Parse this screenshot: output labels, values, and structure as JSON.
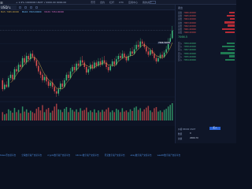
{
  "topbar": {
    "logo": "☰",
    "ticker": "+ 1.9% 1900000 USDT   √ 0000.00   0000.00",
    "tabs": [
      "币币",
      "合约",
      "杠杆",
      "OTC",
      "应用中心",
      "我的资产"
    ]
  },
  "toolbar": {
    "pair": "USD/↓"
  },
  "chart": {
    "ma_legend": [
      "MA5: 7065.00000",
      "MA10: 7063.00000",
      "MA30: 7054.00000"
    ],
    "last_price": "7066.50000",
    "candles": [
      [
        50,
        42,
        52,
        40
      ],
      [
        42,
        46,
        48,
        41
      ],
      [
        46,
        44,
        49,
        43
      ],
      [
        44,
        52,
        54,
        43
      ],
      [
        52,
        55,
        58,
        50
      ],
      [
        55,
        51,
        57,
        49
      ],
      [
        51,
        60,
        62,
        50
      ],
      [
        60,
        58,
        63,
        56
      ],
      [
        58,
        64,
        66,
        57
      ],
      [
        64,
        62,
        67,
        60
      ],
      [
        62,
        70,
        72,
        61
      ],
      [
        70,
        66,
        73,
        64
      ],
      [
        66,
        72,
        75,
        64
      ],
      [
        72,
        69,
        74,
        66
      ],
      [
        69,
        74,
        76,
        67
      ],
      [
        74,
        71,
        77,
        70
      ],
      [
        71,
        68,
        73,
        66
      ],
      [
        68,
        63,
        70,
        61
      ],
      [
        63,
        58,
        66,
        56
      ],
      [
        58,
        55,
        60,
        52
      ],
      [
        55,
        50,
        57,
        48
      ],
      [
        50,
        53,
        56,
        48
      ],
      [
        53,
        49,
        55,
        46
      ],
      [
        49,
        45,
        51,
        43
      ],
      [
        45,
        48,
        50,
        43
      ],
      [
        48,
        44,
        51,
        42
      ],
      [
        44,
        40,
        46,
        38
      ],
      [
        40,
        38,
        43,
        35
      ],
      [
        38,
        42,
        44,
        36
      ],
      [
        42,
        47,
        49,
        40
      ],
      [
        47,
        44,
        50,
        42
      ],
      [
        44,
        50,
        52,
        43
      ],
      [
        50,
        55,
        57,
        49
      ],
      [
        55,
        52,
        58,
        50
      ],
      [
        52,
        58,
        61,
        51
      ],
      [
        58,
        62,
        64,
        56
      ],
      [
        62,
        59,
        65,
        57
      ],
      [
        59,
        65,
        67,
        58
      ],
      [
        65,
        63,
        68,
        60
      ],
      [
        63,
        68,
        71,
        62
      ],
      [
        68,
        66,
        72,
        64
      ],
      [
        66,
        62,
        68,
        60
      ],
      [
        62,
        57,
        64,
        55
      ],
      [
        57,
        60,
        62,
        55
      ],
      [
        60,
        64,
        66,
        58
      ],
      [
        64,
        61,
        67,
        59
      ],
      [
        61,
        66,
        68,
        60
      ],
      [
        66,
        63,
        68,
        61
      ],
      [
        63,
        67,
        70,
        62
      ],
      [
        67,
        64,
        70,
        62
      ],
      [
        64,
        68,
        71,
        63
      ],
      [
        68,
        66,
        72,
        64
      ],
      [
        66,
        62,
        68,
        60
      ],
      [
        62,
        59,
        64,
        57
      ],
      [
        59,
        63,
        65,
        58
      ],
      [
        63,
        67,
        69,
        62
      ],
      [
        67,
        64,
        70,
        62
      ],
      [
        64,
        69,
        72,
        63
      ],
      [
        69,
        72,
        74,
        67
      ],
      [
        72,
        70,
        75,
        68
      ],
      [
        70,
        74,
        77,
        69
      ],
      [
        74,
        71,
        76,
        69
      ],
      [
        71,
        68,
        73,
        66
      ],
      [
        68,
        72,
        74,
        67
      ],
      [
        72,
        76,
        79,
        71
      ],
      [
        76,
        74,
        80,
        72
      ],
      [
        74,
        78,
        82,
        73
      ],
      [
        78,
        82,
        85,
        77
      ],
      [
        82,
        80,
        86,
        78
      ],
      [
        80,
        85,
        88,
        79
      ],
      [
        85,
        83,
        87,
        81
      ],
      [
        83,
        80,
        85,
        78
      ],
      [
        80,
        76,
        82,
        74
      ],
      [
        76,
        73,
        79,
        71
      ],
      [
        73,
        77,
        79,
        72
      ],
      [
        77,
        74,
        79,
        72
      ],
      [
        74,
        70,
        76,
        68
      ],
      [
        70,
        67,
        72,
        65
      ],
      [
        67,
        70,
        72,
        66
      ],
      [
        70,
        73,
        75,
        69
      ],
      [
        73,
        71,
        76,
        69
      ],
      [
        71,
        75,
        77,
        70
      ],
      [
        75,
        78,
        81,
        74
      ],
      [
        78,
        84,
        88,
        77
      ],
      [
        84,
        88,
        92,
        83
      ],
      [
        88,
        95,
        99,
        87
      ]
    ],
    "volumes": [
      30,
      22,
      25,
      40,
      35,
      28,
      45,
      30,
      38,
      26,
      50,
      32,
      40,
      28,
      35,
      30,
      26,
      42,
      48,
      36,
      55,
      30,
      40,
      45,
      28,
      35,
      50,
      60,
      40,
      38,
      30,
      42,
      48,
      30,
      45,
      38,
      32,
      40,
      30,
      44,
      35,
      38,
      46,
      30,
      36,
      30,
      40,
      28,
      36,
      30,
      38,
      32,
      40,
      46,
      30,
      36,
      30,
      42,
      38,
      30,
      44,
      32,
      36,
      30,
      40,
      34,
      46,
      50,
      38,
      44,
      32,
      40,
      46,
      52,
      36,
      30,
      44,
      48,
      32,
      36,
      30,
      38,
      42,
      50,
      56,
      62
    ]
  },
  "orderbook": {
    "title": "卖出",
    "sells": [
      {
        "label": "卖出",
        "price": "7066.00000",
        "depth": 0.25
      },
      {
        "label": "卖出",
        "price": "7065.00000",
        "depth": 0.35
      },
      {
        "label": "卖出",
        "price": "7064.00000",
        "depth": 0.2
      },
      {
        "label": "卖出",
        "price": "7063.00000",
        "depth": 0.45
      },
      {
        "label": "卖出",
        "price": "7062.00000",
        "depth": 0.3
      },
      {
        "label": "卖出",
        "price": "7061.00000",
        "depth": 0.55
      },
      {
        "label": "卖出",
        "price": "7060.00000",
        "depth": 0.4
      }
    ],
    "mid": "7066.5",
    "buys": [
      {
        "label": "买入",
        "price": "7059.00000",
        "depth": 0.35
      },
      {
        "label": "买入",
        "price": "7058.00000",
        "depth": 0.55
      },
      {
        "label": "买入",
        "price": "7057.00000",
        "depth": 0.3
      },
      {
        "label": "买入",
        "price": "7056.00000",
        "depth": 0.6
      },
      {
        "label": "买入",
        "price": "7055.00000",
        "depth": 0.25
      },
      {
        "label": "买入",
        "price": "7054.00000",
        "depth": 0.4
      }
    ]
  },
  "order": {
    "price_label": "价格 83000 USDT",
    "amount_label": "数量",
    "amount_value": "0",
    "total_label": "总额",
    "total_value": "2066.70",
    "buy_button": "买入"
  },
  "links": [
    "token币交易平台",
    "全球数字资产交易平台",
    "crypto数字资产交易平台",
    "bitcoin数字资产交易平台",
    "币安数字资产交易平台",
    "ebay数字资产交易平台",
    "wealth数字资产交易平台"
  ],
  "colors": {
    "up": "#3fbf7f",
    "down": "#e05050",
    "accent": "#2a63d4"
  }
}
